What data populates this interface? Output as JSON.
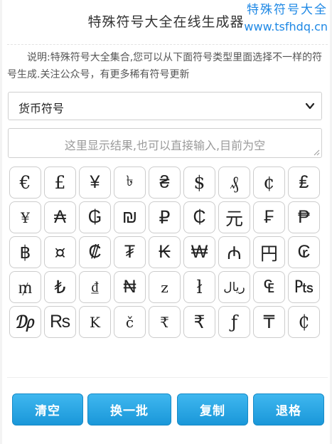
{
  "header": {
    "title": "特殊符号大全在线生成器"
  },
  "watermark": {
    "line1": "特殊符号大全",
    "line2": "www.tsfhdq.cn"
  },
  "description": "说明:特殊符号大全集合,您可以从下面符号类型里面选择不一样的符号生成.关注公众号，有更多稀有符号更新",
  "category_select": {
    "selected": "货币符号"
  },
  "result": {
    "placeholder": "这里显示结果,也可以直接输入,目前为空"
  },
  "symbols": [
    "€",
    "£",
    "¥",
    "৳",
    "₴",
    "$",
    "₰",
    "¢",
    "₤",
    "¥",
    "₳",
    "₲",
    "₪",
    "₽",
    "₵",
    "元",
    "₣",
    "₱",
    "฿",
    "¤",
    "₡",
    "₮",
    "₭",
    "₩",
    "₼",
    "円",
    "₢",
    "₥",
    "₺",
    "₫",
    "₦",
    "z",
    "ł",
    "ریال",
    "₠",
    "₧",
    "₯",
    "₨",
    "K",
    "č",
    "₹",
    "₹",
    "ƒ",
    "₸",
    "₵"
  ],
  "buttons": {
    "clear": "清空",
    "shuffle": "换一批",
    "copy": "复制",
    "backspace": "退格"
  },
  "colors": {
    "button": "#1e9fe0",
    "watermark": "#1e88e5"
  }
}
